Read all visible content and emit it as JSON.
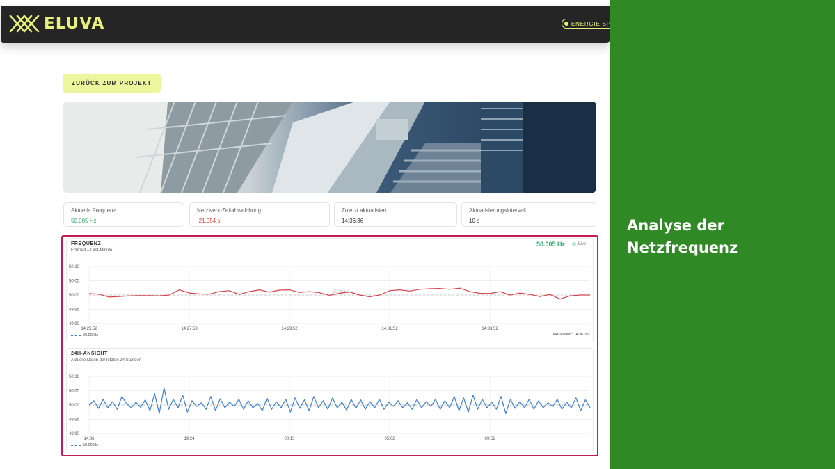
{
  "header": {
    "brand": "ELUVA",
    "energy_label": "ENERGIE SPA"
  },
  "back_button": "ZURÜCK ZUM PROJEKT",
  "stats": [
    {
      "label": "Aktuelle Frequenz",
      "value": "50,005 Hz"
    },
    {
      "label": "Netzwerk-Zeitabweichung",
      "value": "-21,954 s"
    },
    {
      "label": "Zuletzt aktualisiert",
      "value": "14:36:36"
    },
    {
      "label": "Aktualisierungsintervall",
      "value": "10 s"
    }
  ],
  "frequency_chart": {
    "title": "FREQUENZ",
    "subtitle": "Echtzeit – Last-Minute",
    "current": "50.005 Hz",
    "live": "Live",
    "reference_label": "50.00 Hz",
    "legend": "50.00 Hz",
    "updated": "Aktualisiert: 14:36:36"
  },
  "day_chart": {
    "title": "24H-ANSICHT",
    "subtitle": "Aktuelle Daten der letzten 24 Stunden",
    "legend": "50.00 Hz"
  },
  "sidebar": {
    "title": "Analyse der\nNetzfrequenz"
  },
  "colors": {
    "accent": "#e6f07a",
    "panel_border": "#c21b57",
    "green_panel": "#318926",
    "line_red": "#d4434d",
    "line_blue": "#3f7fd8"
  },
  "chart_data": [
    {
      "type": "line",
      "title": "FREQUENZ",
      "ylim": [
        49.9,
        50.1
      ],
      "y_ticks": [
        "50.10",
        "50.05",
        "50.00",
        "49.95",
        "49.90"
      ],
      "x_ticks": [
        "14:25:52",
        "14:27:53",
        "14:29:52",
        "14:31:52",
        "14:33:52"
      ],
      "reference": 50.0,
      "series": [
        {
          "color": "#d4434d",
          "x": [
            0,
            0.02,
            0.04,
            0.06,
            0.08,
            0.1,
            0.12,
            0.14,
            0.16,
            0.18,
            0.2,
            0.22,
            0.24,
            0.26,
            0.28,
            0.3,
            0.32,
            0.34,
            0.36,
            0.38,
            0.4,
            0.42,
            0.44,
            0.46,
            0.48,
            0.5,
            0.52,
            0.54,
            0.56,
            0.58,
            0.6,
            0.62,
            0.64,
            0.66,
            0.68,
            0.7,
            0.72,
            0.74,
            0.76,
            0.78,
            0.8,
            0.82,
            0.84,
            0.86,
            0.88,
            0.9,
            0.92,
            0.94,
            0.96,
            0.98,
            1.0
          ],
          "values": [
            50.005,
            50.003,
            49.993,
            49.995,
            49.997,
            49.998,
            49.998,
            49.997,
            50.0,
            50.018,
            50.007,
            50.004,
            50.003,
            50.012,
            50.015,
            50.002,
            50.012,
            50.018,
            50.01,
            50.017,
            50.018,
            50.009,
            50.012,
            50.008,
            49.999,
            50.006,
            50.011,
            50.0,
            49.994,
            50.0,
            50.015,
            50.018,
            50.014,
            50.02,
            50.022,
            50.023,
            50.02,
            50.024,
            50.012,
            50.006,
            50.005,
            50.012,
            50.0,
            50.007,
            50.002,
            49.995,
            50.002,
            49.986,
            49.997,
            50.0,
            50.0
          ]
        }
      ]
    },
    {
      "type": "line",
      "title": "24H-ANSICHT",
      "ylim": [
        49.9,
        50.1
      ],
      "y_ticks": [
        "50.10",
        "50.05",
        "50.00",
        "49.95",
        "49.90"
      ],
      "x_ticks": [
        "14:36",
        "19:24",
        "00:13",
        "05:02",
        "09:51"
      ],
      "reference": 50.0,
      "series": [
        {
          "color": "#3f7fd8",
          "values": [
            50.0,
            50.015,
            49.988,
            50.02,
            49.99,
            50.012,
            49.985,
            50.03,
            50.005,
            49.99,
            50.01,
            49.992,
            50.018,
            49.98,
            50.04,
            49.97,
            50.06,
            49.985,
            50.02,
            49.99,
            50.035,
            49.975,
            50.015,
            49.995,
            50.008,
            49.985,
            50.03,
            49.98,
            50.022,
            49.99,
            50.01,
            49.995,
            50.02,
            49.985,
            50.015,
            49.99,
            50.005,
            49.98,
            50.025,
            49.985,
            50.012,
            49.99,
            50.02,
            49.975,
            50.025,
            49.988,
            50.018,
            49.98,
            50.03,
            49.99,
            50.015,
            49.985,
            50.025,
            49.99,
            50.01,
            49.982,
            50.02,
            49.988,
            50.018,
            49.985,
            50.012,
            49.99,
            50.02,
            49.985,
            50.01,
            49.995,
            50.015,
            49.99,
            50.008,
            49.985,
            50.02,
            49.99,
            50.012,
            49.995,
            50.02,
            49.985,
            50.015,
            49.99,
            50.03,
            49.98,
            50.025,
            49.975,
            50.035,
            49.985,
            50.02,
            49.99,
            50.01,
            49.985,
            50.03,
            49.97,
            50.02,
            49.988,
            50.012,
            49.99,
            50.02,
            49.985,
            50.015,
            49.99,
            50.008,
            49.995,
            50.02,
            49.985,
            50.01,
            49.99,
            50.025,
            49.98,
            50.018,
            49.99
          ]
        }
      ]
    }
  ]
}
